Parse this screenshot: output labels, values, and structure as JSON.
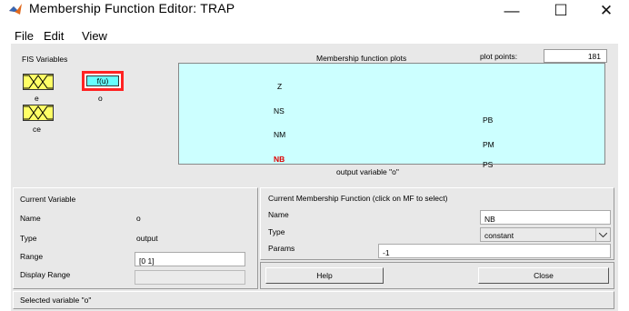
{
  "window": {
    "title": "Membership Function Editor: TRAP",
    "minimize_glyph": "—",
    "maximize_glyph": "☐",
    "close_glyph": "✕",
    "icon": "matlab-icon"
  },
  "menu": {
    "file": "File",
    "edit": "Edit",
    "view": "View"
  },
  "fis_variables": {
    "title": "FIS Variables",
    "inputs": [
      {
        "name": "e"
      },
      {
        "name": "ce"
      }
    ],
    "output": {
      "name": "o",
      "box_label": "f(u)",
      "selected": true
    }
  },
  "plot": {
    "title": "Membership function plots",
    "plot_points_label": "plot points:",
    "plot_points_value": "181",
    "x_label": "output variable \"o\"",
    "mfs": [
      "Z",
      "NS",
      "NM",
      "NB",
      "PB",
      "PM",
      "PS"
    ],
    "selected_mf": "NB"
  },
  "current_variable": {
    "title": "Current Variable",
    "name_label": "Name",
    "name_value": "o",
    "type_label": "Type",
    "type_value": "output",
    "range_label": "Range",
    "range_value": "[0 1]",
    "display_range_label": "Display Range",
    "display_range_value": ""
  },
  "current_mf": {
    "title": "Current Membership Function (click on MF to select)",
    "name_label": "Name",
    "name_value": "NB",
    "type_label": "Type",
    "type_value": "constant",
    "params_label": "Params",
    "params_value": "-1"
  },
  "buttons": {
    "help": "Help",
    "close": "Close"
  },
  "status": "Selected variable \"o\"",
  "colors": {
    "panel": "#e8e8e8",
    "plot_bg": "#ccffff",
    "input_var": "#ffff66",
    "output_var": "#66ffff",
    "selected": "#dd0000"
  }
}
